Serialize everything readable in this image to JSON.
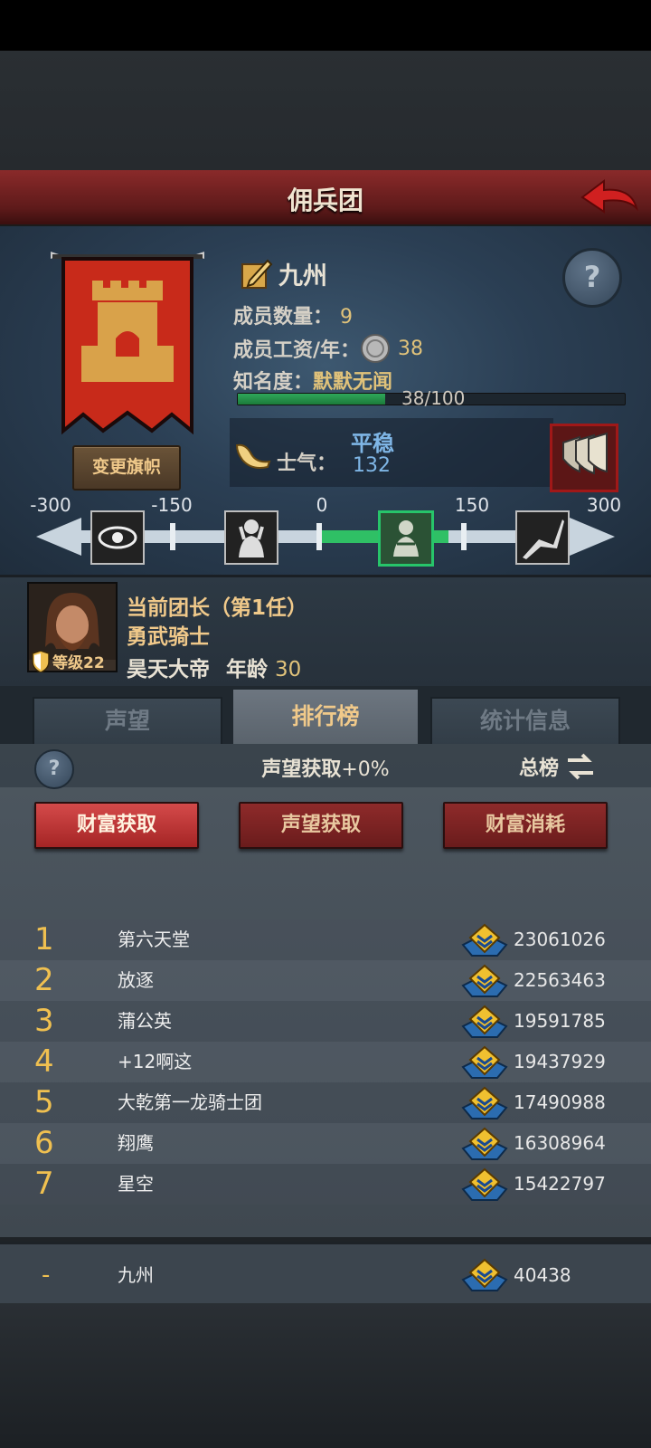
{
  "header": {
    "title": "佣兵团"
  },
  "guild": {
    "name": "九州",
    "members_label": "成员数量：",
    "members_value": "9",
    "salary_label": "成员工资/年：",
    "salary_value": "38",
    "fame_label": "知名度：",
    "fame_value": "默默无闻",
    "fame_progress_text": "38/100",
    "fame_progress": 0.38,
    "change_flag_label": "变更旗帜"
  },
  "morale": {
    "label": "士气：",
    "state": "平稳",
    "value": "132",
    "ticks": [
      "-300",
      "-150",
      "0",
      "150",
      "300"
    ],
    "icons": [
      "eye-icon",
      "distressed-icon",
      "calm-icon",
      "charging-icon"
    ]
  },
  "captain": {
    "line1": "当前团长（第1任）",
    "title": "勇武骑士",
    "name": "昊天大帝",
    "age_label": "年龄",
    "age_value": "30",
    "level_text": "等级22"
  },
  "tabs": [
    "声望",
    "排行榜",
    "统计信息"
  ],
  "board": {
    "rep_label": "声望获取",
    "rep_pct": "+0%",
    "total_label": "总榜",
    "buttons": [
      "财富获取",
      "声望获取",
      "财富消耗"
    ],
    "rows": [
      {
        "rank": "1",
        "name": "第六天堂",
        "value": "23061026"
      },
      {
        "rank": "2",
        "name": "放逐",
        "value": "22563463"
      },
      {
        "rank": "3",
        "name": "蒲公英",
        "value": "19591785"
      },
      {
        "rank": "4",
        "name": "+12啊这",
        "value": "19437929"
      },
      {
        "rank": "5",
        "name": "大乾第一龙骑士团",
        "value": "17490988"
      },
      {
        "rank": "6",
        "name": "翔鹰",
        "value": "16308964"
      },
      {
        "rank": "7",
        "name": "星空",
        "value": "15422797"
      }
    ],
    "self": {
      "rank": "-",
      "name": "九州",
      "value": "40438"
    }
  },
  "colors": {
    "accent": "#f0c050",
    "title_red": "#8a2a2a",
    "active_green": "#27c56a"
  }
}
